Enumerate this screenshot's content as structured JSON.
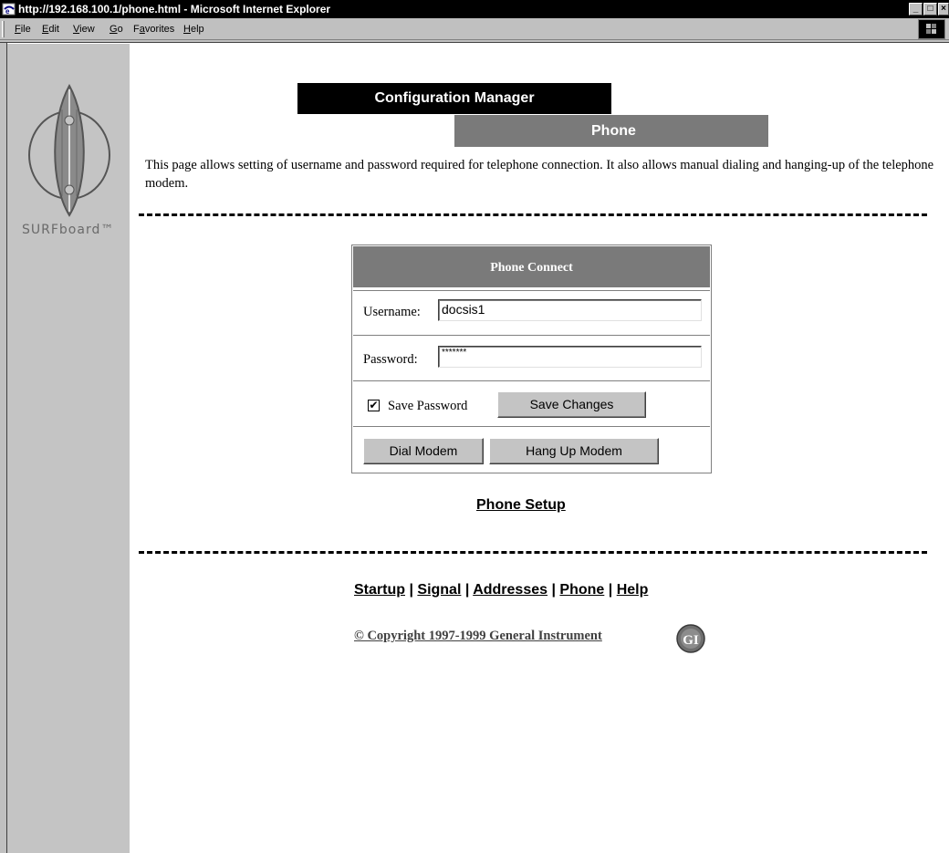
{
  "window": {
    "title": "http://192.168.100.1/phone.html - Microsoft Internet Explorer",
    "controls": [
      "_",
      "□",
      "×"
    ]
  },
  "menu": [
    {
      "label": "File",
      "key": "F"
    },
    {
      "label": "Edit",
      "key": "E"
    },
    {
      "label": "View",
      "key": "V"
    },
    {
      "label": "Go",
      "key": "G"
    },
    {
      "label": "Favorites",
      "key": "a"
    },
    {
      "label": "Help",
      "key": "H"
    }
  ],
  "logo": {
    "text": "SURFboard™"
  },
  "header": {
    "banner": "Configuration Manager",
    "page": "Phone"
  },
  "intro": "This page allows setting of username and password required for telephone connection. It also allows manual dialing and hanging-up of the telephone modem.",
  "form": {
    "title": "Phone Connect",
    "username_label": "Username:",
    "username_value": "docsis1",
    "password_label": "Password:",
    "password_value": "*******",
    "save_password_checked": true,
    "save_password_label": "Save Password",
    "save_changes": "Save Changes",
    "dial": "Dial Modem",
    "hangup": "Hang Up Modem"
  },
  "phone_setup_link": "Phone Setup",
  "footer": {
    "nav": [
      "Startup",
      "Signal",
      "Addresses",
      "Phone",
      "Help"
    ],
    "separator": "|",
    "copyright": "© Copyright 1997-1999 General Instrument",
    "gi_logo": "GI"
  },
  "colors": {
    "sidebar": "#c4c4c4",
    "banner_dark": "#000000",
    "banner_gray": "#7a7a7a"
  }
}
